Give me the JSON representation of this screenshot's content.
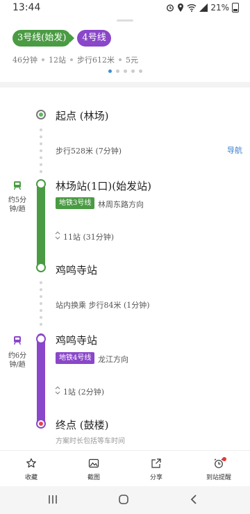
{
  "status": {
    "time": "13:44",
    "battery": "21%"
  },
  "header": {
    "line_chips": [
      {
        "label": "3号线(始发)",
        "color": "#4a9b43"
      },
      {
        "label": "4号线",
        "color": "#8a47c9"
      }
    ],
    "summary": [
      "46分钟",
      "12站",
      "步行612米",
      "5元"
    ],
    "pager": {
      "count": 5,
      "active": 0
    }
  },
  "route": {
    "start": {
      "label": "起点 (林场)"
    },
    "walk1": {
      "text": "步行528米 (7分钟)",
      "nav_label": "导航"
    },
    "segment1": {
      "side_label": "约5分钟/趟",
      "board_station": "林场站(1口)(始发站)",
      "line_badge": "地铁3号线",
      "direction": "林周东路方向",
      "stops": "11站 (31分钟)",
      "alight_station": "鸡鸣寺站",
      "color": "#4a9b43"
    },
    "transfer": {
      "text": "站内换乘 步行84米 (1分钟)"
    },
    "segment2": {
      "side_label": "约6分钟/趟",
      "board_station": "鸡鸣寺站",
      "line_badge": "地铁4号线",
      "direction": "龙江方向",
      "stops": "1站 (2分钟)",
      "color": "#8a47c9"
    },
    "end": {
      "label": "终点 (鼓楼)",
      "note": "方案时长包括等车时间"
    }
  },
  "toolbar": {
    "items": [
      {
        "label": "收藏",
        "icon": "star-icon"
      },
      {
        "label": "截图",
        "icon": "image-icon"
      },
      {
        "label": "分享",
        "icon": "share-icon"
      },
      {
        "label": "到站提醒",
        "icon": "alarm-icon"
      }
    ]
  }
}
